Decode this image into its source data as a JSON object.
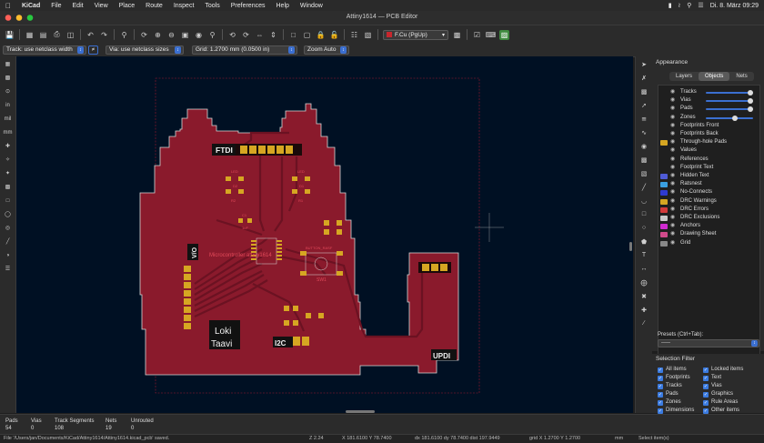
{
  "menubar": {
    "app": "KiCad",
    "items": [
      "File",
      "Edit",
      "View",
      "Place",
      "Route",
      "Inspect",
      "Tools",
      "Preferences",
      "Help",
      "Window"
    ],
    "clock": "Di. 8. März 09:29"
  },
  "window": {
    "title": "Attiny1614 — PCB Editor"
  },
  "toolbar": {
    "layer": "F.Cu (PgUp)"
  },
  "optbar": {
    "track": "Track: use netclass width",
    "via": "Via: use netclass sizes",
    "grid": "Grid: 1.2700 mm (0.0500 in)",
    "zoom": "Zoom Auto"
  },
  "left_toolbar": {
    "units": [
      "in",
      "mil",
      "mm"
    ]
  },
  "board": {
    "labels": {
      "ftdi": "FTDI",
      "loki": "Loki",
      "taavi": "Taavi",
      "i2c": "I2C",
      "updi": "UPDI",
      "vo": "V/O",
      "mcu": "Microcontroller attiny1614",
      "button": "BUTTON_RASF",
      "sw1": "SW1",
      "led1": "LED",
      "led2": "LED",
      "r2": "R2",
      "r1": "R1",
      "d2": "D2",
      "d1": "D1",
      "c1": "C1",
      "c1v": "1uF"
    }
  },
  "appearance": {
    "title": "Appearance",
    "tabs": [
      "Layers",
      "Objects",
      "Nets"
    ],
    "active_tab": "Objects",
    "objects": [
      {
        "label": "Tracks",
        "slider": 0.95,
        "color": ""
      },
      {
        "label": "Vias",
        "slider": 0.95,
        "color": ""
      },
      {
        "label": "Pads",
        "slider": 0.95,
        "color": ""
      },
      {
        "label": "Zones",
        "slider": 0.6,
        "color": ""
      },
      {
        "label": "Footprints Front",
        "color": ""
      },
      {
        "label": "Footprints Back",
        "color": ""
      },
      {
        "label": "Through-hole Pads",
        "color": "#d6a622"
      },
      {
        "label": "Values",
        "color": ""
      },
      {
        "label": "References",
        "color": ""
      },
      {
        "label": "Footprint Text",
        "color": ""
      },
      {
        "label": "Hidden Text",
        "color": "#4f5bd6"
      },
      {
        "label": "Ratsnest",
        "color": "#3aa0e0"
      },
      {
        "label": "No-Connects",
        "color": "#2e3ad0"
      },
      {
        "label": "DRC Warnings",
        "color": "#d6a622"
      },
      {
        "label": "DRC Errors",
        "color": "#d23a3a"
      },
      {
        "label": "DRC Exclusions",
        "color": "#c8c8c8"
      },
      {
        "label": "Anchors",
        "color": "#d02ad0"
      },
      {
        "label": "Drawing Sheet",
        "color": "#d04a8a"
      },
      {
        "label": "Grid",
        "color": "#888888"
      }
    ],
    "presets_label": "Presets (Ctrl+Tab):",
    "presets_value": "-----"
  },
  "selection_filter": {
    "title": "Selection Filter",
    "left": [
      "All items",
      "Footprints",
      "Tracks",
      "Pads",
      "Zones",
      "Dimensions"
    ],
    "right": [
      "Locked items",
      "Text",
      "Vias",
      "Graphics",
      "Rule Areas",
      "Other items"
    ]
  },
  "messages": {
    "pads_label": "Pads",
    "pads_value": "54",
    "vias_label": "Vias",
    "vias_value": "0",
    "tracks_label": "Track Segments",
    "tracks_value": "108",
    "nets_label": "Nets",
    "nets_value": "19",
    "unrouted_label": "Unrouted",
    "unrouted_value": "0"
  },
  "status": {
    "file": "File '/Users/jan/Documents/KiCad/Attiny1614/Attiny1614.kicad_pcb' saved.",
    "z": "Z 2.24",
    "xy": "X 181.6100  Y 78.7400",
    "dxy": "dx 181.6100  dy 78.7400  dist 197.9449",
    "grid": "grid X 1.2700  Y 1.2700",
    "units": "mm",
    "select": "Select item(s)"
  },
  "colors": {
    "canvas": "#001023",
    "copper_zone": "#8a1a2c",
    "pad": "#d6a622",
    "edge": "#d8d8d8"
  }
}
